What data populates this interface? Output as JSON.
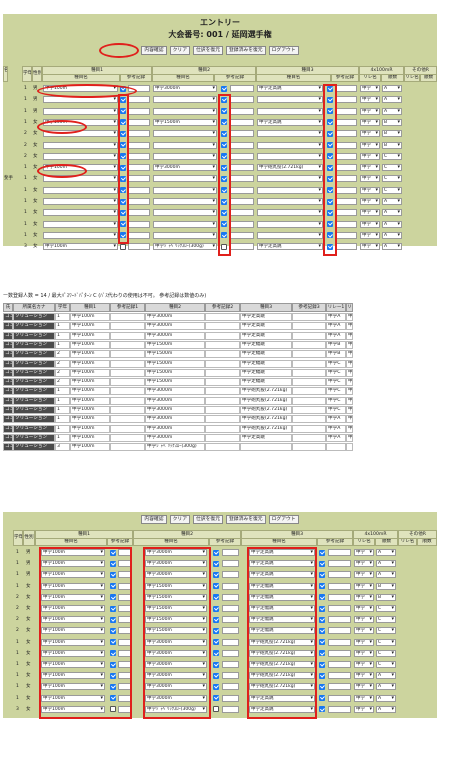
{
  "panel1": {
    "title": "エントリー",
    "subtitle": "大会番号: 001 / 延岡選手権",
    "buttons": [
      "内容確認",
      "クリア",
      "仕訳を復元",
      "登録済みを復元",
      "ログアウト"
    ],
    "headers": {
      "grade": "学年",
      "sex": "性別",
      "left_cut": "名",
      "event1": "種目1",
      "event2": "種目2",
      "event3": "種目3",
      "relay": "4x100mR",
      "other": "その他R",
      "event_name": "種目名",
      "ref_record": "参考記録",
      "relay_sub": [
        "リレ名",
        "順数"
      ],
      "other_sub": [
        "リレ名",
        "順数"
      ]
    },
    "rows": [
      {
        "left": "",
        "grade": "1",
        "sex": "男",
        "e1": "中学100m",
        "c1": true,
        "e2": "中学3000m",
        "c2": true,
        "e3": "中学走高跳",
        "c3": true,
        "r": "中学",
        "rn": "A"
      },
      {
        "left": "",
        "grade": "1",
        "sex": "男",
        "e1": "",
        "c1": true,
        "e2": "",
        "c2": true,
        "e3": "",
        "c3": true,
        "r": "中学",
        "rn": "A"
      },
      {
        "left": "",
        "grade": "1",
        "sex": "男",
        "e1": "",
        "c1": true,
        "e2": "",
        "c2": true,
        "e3": "",
        "c3": true,
        "r": "中学",
        "rn": "A"
      },
      {
        "left": "",
        "grade": "1",
        "sex": "女",
        "e1": "中学100m",
        "c1": true,
        "e2": "中学1500m",
        "c2": true,
        "e3": "中学走高跳",
        "c3": true,
        "r": "中学",
        "rn": "B"
      },
      {
        "left": "",
        "grade": "2",
        "sex": "女",
        "e1": "",
        "c1": true,
        "e2": "",
        "c2": true,
        "e3": "",
        "c3": true,
        "r": "中学",
        "rn": "B"
      },
      {
        "left": "",
        "grade": "2",
        "sex": "女",
        "e1": "",
        "c1": true,
        "e2": "",
        "c2": true,
        "e3": "",
        "c3": true,
        "r": "中学",
        "rn": "B"
      },
      {
        "left": "",
        "grade": "2",
        "sex": "女",
        "e1": "",
        "c1": true,
        "e2": "",
        "c2": true,
        "e3": "",
        "c3": true,
        "r": "中学",
        "rn": "C"
      },
      {
        "left": "",
        "grade": "1",
        "sex": "女",
        "e1": "中学100m",
        "c1": true,
        "e2": "中学3000m",
        "c2": true,
        "e3": "中学砲丸投(2.721kg)",
        "c3": true,
        "r": "中学",
        "rn": "C"
      },
      {
        "left": "斐手",
        "grade": "1",
        "sex": "女",
        "e1": "",
        "c1": true,
        "e2": "",
        "c2": true,
        "e3": "",
        "c3": true,
        "r": "中学",
        "rn": "C"
      },
      {
        "left": "",
        "grade": "1",
        "sex": "女",
        "e1": "",
        "c1": true,
        "e2": "",
        "c2": true,
        "e3": "",
        "c3": true,
        "r": "中学",
        "rn": "C"
      },
      {
        "left": "",
        "grade": "1",
        "sex": "女",
        "e1": "",
        "c1": true,
        "e2": "",
        "c2": true,
        "e3": "",
        "c3": true,
        "r": "中学",
        "rn": "A"
      },
      {
        "left": "",
        "grade": "1",
        "sex": "女",
        "e1": "",
        "c1": true,
        "e2": "",
        "c2": true,
        "e3": "",
        "c3": true,
        "r": "中学",
        "rn": "A"
      },
      {
        "left": "",
        "grade": "1",
        "sex": "女",
        "e1": "",
        "c1": true,
        "e2": "",
        "c2": true,
        "e3": "",
        "c3": true,
        "r": "中学",
        "rn": "A"
      },
      {
        "left": "",
        "grade": "1",
        "sex": "女",
        "e1": "",
        "c1": true,
        "e2": "",
        "c2": true,
        "e3": "",
        "c3": true,
        "r": "中学",
        "rn": "A"
      },
      {
        "left": "",
        "grade": "3",
        "sex": "女",
        "e1": "中学100m",
        "c1": false,
        "e2": "中学ｼﾞｬﾍﾞﾘｯｸｽﾛｰ(300g)",
        "c2": false,
        "e3": "中学走高跳",
        "c3": true,
        "r": "中学",
        "rn": "A"
      }
    ]
  },
  "panel2": {
    "header": "ー数登録人数 = 14 / 最大ﾊﾟｽﾜｰﾄﾞﾊﾟﾀｰﾝ C (ﾊﾞｽ代わりの使用は不可。 参考記録は数値のみ)",
    "columns": [
      "氏",
      "所属名カナ",
      "学年",
      "種目1",
      "参考記録1",
      "種目2",
      "参考記録2",
      "種目3",
      "参考記録3",
      "リレー1",
      "リレ"
    ],
    "rows": [
      {
        "a": "コン",
        "b": "ソリューション",
        "g": "1",
        "e1": "中学100m",
        "e2": "中学3000m",
        "e3": "中学走高跳",
        "r": "中学A",
        "x": "中"
      },
      {
        "a": "コン",
        "b": "ソリューション",
        "g": "1",
        "e1": "中学100m",
        "e2": "中学3000m",
        "e3": "中学走高跳",
        "r": "中学A",
        "x": "中"
      },
      {
        "a": "コン",
        "b": "ソリューション",
        "g": "1",
        "e1": "中学100m",
        "e2": "中学3000m",
        "e3": "中学走高跳",
        "r": "中学A",
        "x": "中"
      },
      {
        "a": "コン",
        "b": "ソリューション",
        "g": "1",
        "e1": "中学100m",
        "e2": "中学1500m",
        "e3": "中学走幅跳",
        "r": "中学B",
        "x": "中"
      },
      {
        "a": "コン",
        "b": "ソリューション",
        "g": "2",
        "e1": "中学100m",
        "e2": "中学1500m",
        "e3": "中学走幅跳",
        "r": "中学B",
        "x": "中"
      },
      {
        "a": "コン",
        "b": "ソリューション",
        "g": "2",
        "e1": "中学100m",
        "e2": "中学1500m",
        "e3": "中学走幅跳",
        "r": "中学C",
        "x": "中"
      },
      {
        "a": "コン",
        "b": "ソリューション",
        "g": "2",
        "e1": "中学100m",
        "e2": "中学1500m",
        "e3": "中学走幅跳",
        "r": "中学C",
        "x": "中"
      },
      {
        "a": "コン",
        "b": "ソリューション",
        "g": "2",
        "e1": "中学100m",
        "e2": "中学1500m",
        "e3": "中学走幅跳",
        "r": "中学C",
        "x": "中"
      },
      {
        "a": "コン",
        "b": "ソリューション",
        "g": "1",
        "e1": "中学100m",
        "e2": "中学3000m",
        "e3": "中学砲丸投(2.721kg)",
        "r": "中学C",
        "x": "中"
      },
      {
        "a": "コン",
        "b": "ソリューション",
        "g": "1",
        "e1": "中学100m",
        "e2": "中学3000m",
        "e3": "中学砲丸投(2.721kg)",
        "r": "中学C",
        "x": "中"
      },
      {
        "a": "コン",
        "b": "ソリューション",
        "g": "1",
        "e1": "中学100m",
        "e2": "中学3000m",
        "e3": "中学砲丸投(2.721kg)",
        "r": "中学C",
        "x": "中"
      },
      {
        "a": "コン",
        "b": "ソリューション",
        "g": "1",
        "e1": "中学100m",
        "e2": "中学3000m",
        "e3": "中学砲丸投(2.721kg)",
        "r": "中学A",
        "x": "中"
      },
      {
        "a": "コン",
        "b": "ソリューション",
        "g": "1",
        "e1": "中学100m",
        "e2": "中学3000m",
        "e3": "中学砲丸投(2.721kg)",
        "r": "中学A",
        "x": "中"
      },
      {
        "a": "コン",
        "b": "ソリューション",
        "g": "1",
        "e1": "中学100m",
        "e2": "中学3000m",
        "e3": "中学走高跳",
        "r": "中学A",
        "x": "中"
      },
      {
        "a": "コン",
        "b": "ソリューション",
        "g": "3",
        "e1": "中学100m",
        "e2": "中学ｼﾞｬﾍﾞﾘｯｸｽﾛｰ(300g)",
        "e3": "",
        "r": "",
        "x": ""
      }
    ]
  },
  "panel3": {
    "buttons": [
      "内容確認",
      "クリア",
      "仕訳を復元",
      "登録済みを復元",
      "ログアウト"
    ],
    "rows": [
      {
        "grade": "1",
        "sex": "男",
        "e1": "中学100m",
        "e2": "中学3000m",
        "e3": "中学走高跳",
        "rn": "A",
        "c1": true
      },
      {
        "grade": "1",
        "sex": "男",
        "e1": "中学100m",
        "e2": "中学3000m",
        "e3": "中学走高跳",
        "rn": "A",
        "c1": true
      },
      {
        "grade": "1",
        "sex": "男",
        "e1": "中学100m",
        "e2": "中学3000m",
        "e3": "中学走高跳",
        "rn": "A",
        "c1": true
      },
      {
        "grade": "1",
        "sex": "女",
        "e1": "中学100m",
        "e2": "中学1500m",
        "e3": "中学走幅跳",
        "rn": "B",
        "c1": true
      },
      {
        "grade": "2",
        "sex": "女",
        "e1": "中学100m",
        "e2": "中学1500m",
        "e3": "中学走幅跳",
        "rn": "B",
        "c1": true
      },
      {
        "grade": "2",
        "sex": "女",
        "e1": "中学100m",
        "e2": "中学1500m",
        "e3": "中学走幅跳",
        "rn": "C",
        "c1": true
      },
      {
        "grade": "2",
        "sex": "女",
        "e1": "中学100m",
        "e2": "中学1500m",
        "e3": "中学走幅跳",
        "rn": "C",
        "c1": true
      },
      {
        "grade": "2",
        "sex": "女",
        "e1": "中学100m",
        "e2": "中学1500m",
        "e3": "中学走幅跳",
        "rn": "C",
        "c1": true
      },
      {
        "grade": "1",
        "sex": "女",
        "e1": "中学100m",
        "e2": "中学3000m",
        "e3": "中学砲丸投(2.721kg)",
        "rn": "C",
        "c1": true
      },
      {
        "grade": "1",
        "sex": "女",
        "e1": "中学100m",
        "e2": "中学3000m",
        "e3": "中学砲丸投(2.721kg)",
        "rn": "C",
        "c1": true
      },
      {
        "grade": "1",
        "sex": "女",
        "e1": "中学100m",
        "e2": "中学3000m",
        "e3": "中学砲丸投(2.721kg)",
        "rn": "C",
        "c1": true
      },
      {
        "grade": "1",
        "sex": "女",
        "e1": "中学100m",
        "e2": "中学3000m",
        "e3": "中学砲丸投(2.721kg)",
        "rn": "A",
        "c1": true
      },
      {
        "grade": "1",
        "sex": "女",
        "e1": "中学100m",
        "e2": "中学3000m",
        "e3": "中学砲丸投(2.721kg)",
        "rn": "A",
        "c1": true
      },
      {
        "grade": "1",
        "sex": "女",
        "e1": "中学100m",
        "e2": "中学3000m",
        "e3": "中学走高跳",
        "rn": "A",
        "c1": true
      },
      {
        "grade": "3",
        "sex": "女",
        "e1": "中学100m",
        "e2": "中学ｼﾞｬﾍﾞﾘｯｸｽﾛｰ(300g)",
        "e3": "中学走高跳",
        "rn": "A",
        "c1": false
      }
    ]
  }
}
